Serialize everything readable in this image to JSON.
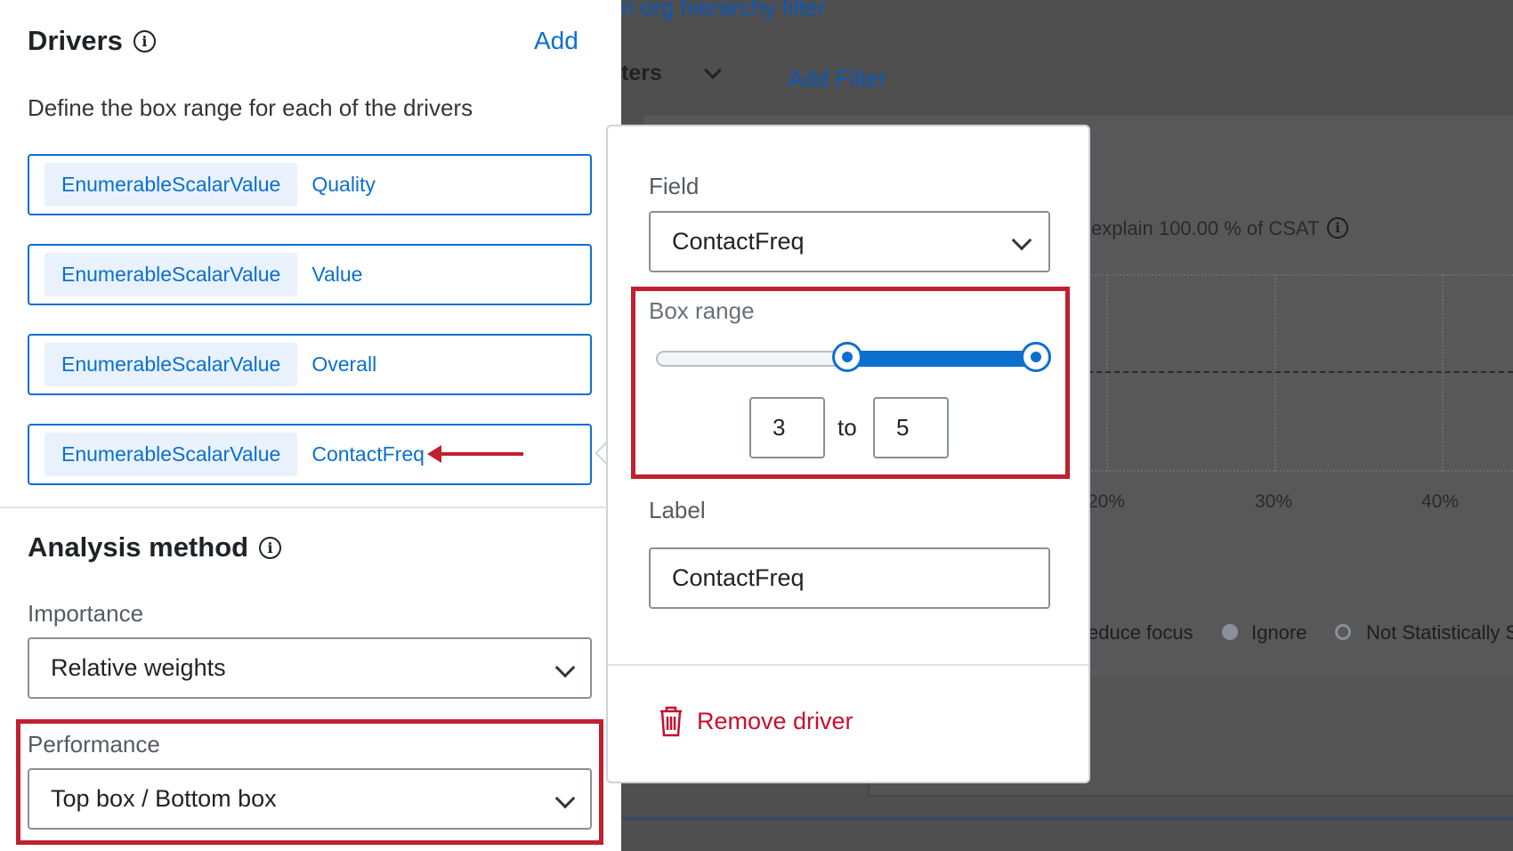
{
  "background": {
    "top_link": "n org hierarchy filter",
    "filters_heading": "ters",
    "add_filter": "Add Filter",
    "explain_text": "explain 100.00 % of CSAT",
    "axis_ticks": [
      "20%",
      "30%",
      "40%"
    ],
    "legend": [
      {
        "label": "educe focus"
      },
      {
        "label": "Ignore"
      },
      {
        "label": "Not Statistically S"
      }
    ]
  },
  "drivers": {
    "title": "Drivers",
    "add_label": "Add",
    "description": "Define the box range for each of the drivers",
    "items": [
      {
        "type": "EnumerableScalarValue",
        "name": "Quality"
      },
      {
        "type": "EnumerableScalarValue",
        "name": "Value"
      },
      {
        "type": "EnumerableScalarValue",
        "name": "Overall"
      },
      {
        "type": "EnumerableScalarValue",
        "name": "ContactFreq"
      }
    ]
  },
  "analysis": {
    "title": "Analysis method",
    "importance_label": "Importance",
    "importance_value": "Relative weights",
    "performance_label": "Performance",
    "performance_value": "Top box / Bottom box"
  },
  "popover": {
    "field_label": "Field",
    "field_value": "ContactFreq",
    "box_range_label": "Box range",
    "range_min": "3",
    "range_to": "to",
    "range_max": "5",
    "slider_low_fraction": 0.5,
    "slider_high_fraction": 1.0,
    "label_label": "Label",
    "label_value": "ContactFreq",
    "remove_label": "Remove driver"
  },
  "colors": {
    "accent": "#0b6fd0",
    "highlight": "#c02030",
    "danger": "#c7102d"
  },
  "icons": [
    "info-icon",
    "chevron-down-icon",
    "trash-icon",
    "arrow-left-icon"
  ]
}
